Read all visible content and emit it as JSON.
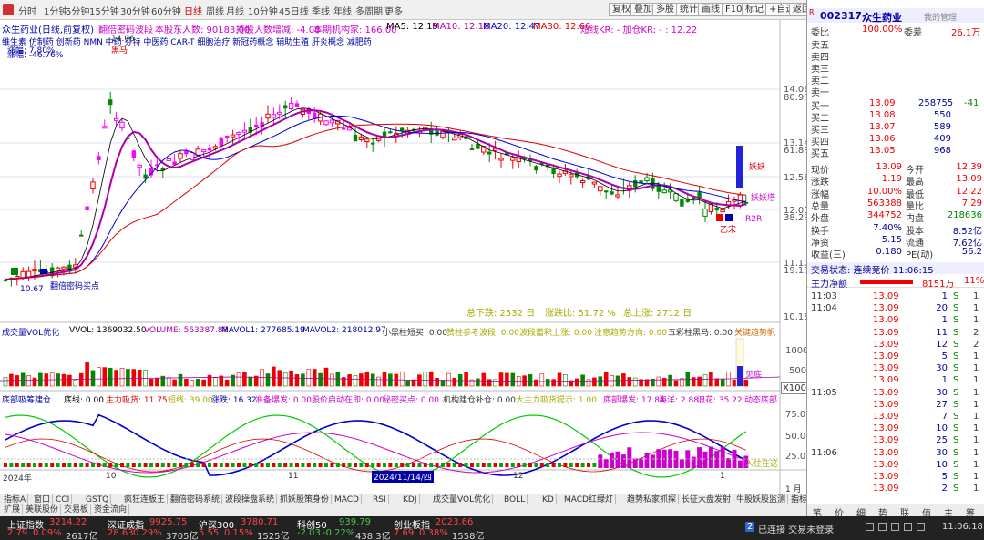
{
  "toolbar": {
    "periods": [
      "分时",
      "1分钟",
      "5分钟",
      "15分钟",
      "30分钟",
      "60分钟",
      "日线",
      "周线",
      "月线",
      "10分钟",
      "45日线",
      "季线",
      "年线",
      "多周期",
      "更多"
    ],
    "active_period": "日线",
    "buttons": [
      "复权",
      "叠加",
      "多股",
      "统计",
      "画线",
      "F10",
      "标记",
      "+自选",
      "返回"
    ]
  },
  "info": {
    "stock_line": "众生药业(日线,前复权)",
    "indicator": "翻倍密码波段",
    "holders": "本股东人数: 90183.00",
    "holders_change": "持股人数增减: -4.08",
    "inst_count": "本期机构家: 166.00",
    "ma5": "MA5: 12.19",
    "ma10": "MA10: 12.18",
    "ma20": "MA20: 12.47",
    "ma30": "MA30: 12.66",
    "macro": "短线KR: - 加仓KR: - : 12.22",
    "concepts": "维生素 仿制药 创新药 NMN 中药 芬特 中医药 CAR-T 细胞治疗 新冠药概念 辅助生殖 肝炎概念 减肥药",
    "float1": "涨幅: 7.80%",
    "float2": "涨幅: -46.76%",
    "hl_high": "14.06",
    "hl_low": "10.67",
    "label_tag": "翻倍密码买点",
    "label_black": "黑马",
    "label_yao": "妖妖",
    "label_yaota": "妖妖塔",
    "label_nie": "乙宋",
    "label_rzr": "R2R",
    "label_z": "乙",
    "stats_down": "总下跌: 2532 日",
    "stats_rate": "涨跌比: 51.72 %",
    "stats_up": "总上涨: 2712 日"
  },
  "yaxis_price": [
    {
      "v": "14.06",
      "c": "dark"
    },
    {
      "v": "80.9%",
      "c": "dark"
    },
    {
      "v": "13.14",
      "c": "dark"
    },
    {
      "v": "61.8%",
      "c": "dark"
    },
    {
      "v": "12.58",
      "c": "dark"
    },
    {
      "v": "12.01",
      "c": "dark"
    },
    {
      "v": "38.2%",
      "c": "dark"
    },
    {
      "v": "11.10",
      "c": "dark"
    },
    {
      "v": "19.1%",
      "c": "dark"
    },
    {
      "v": "10.18",
      "c": "dark"
    }
  ],
  "vol_panel": {
    "title": "成交量VOL优化",
    "vvol": "VVOL: 1369032.50",
    "volume": "VOLUME: 563387.88",
    "mavol1": "MAVOL1: 277685.19",
    "mavol2": "MAVOL2: 218012.97",
    "xiao": "小黑柱短买: 0.00",
    "hong": "赞柱参考波段: 0.00",
    "bo": "波段蓄积上涨: 0.00",
    "zhu": "注意趋势方向: 0.00",
    "wu": "五彩柱黑马: 0.00",
    "key": "关键趋势帆",
    "yticks": [
      "10000",
      "5000"
    ],
    "label": "见底"
  },
  "osc_panel": {
    "title": "底部吸筹建仓",
    "d1": "底线: 0.00",
    "d2": "主力吸货: 11.75",
    "d3": "短线: 39.00",
    "d4": "涨跌: 16.32",
    "d5": "准备爆发: 0.00",
    "d6": "股价启动在即: 0.00",
    "d7": "秘密买点: 0.00",
    "d8": "机构建仓补仓: 0.00",
    "d9": "大主力吸货提示: 1.00",
    "d10": "底部爆发: 17.84",
    "d11": "海洋: 2.88",
    "d12": "浪花: 35.22",
    "d13": "动态底部",
    "yticks": [
      "75.00",
      "50.00",
      "25.00"
    ],
    "label": "入住在这",
    "x100": "X100"
  },
  "xaxis": [
    "2024年",
    "10",
    "11",
    "2024/11/14/四",
    "12",
    "1",
    "1 月"
  ],
  "bottom_tabs": [
    "指标A",
    "窗口",
    "CCI",
    "GSTQ",
    "疯狂连板王",
    "翻倍密码系统",
    "波段操盘系统",
    "抓妖股策身份",
    "MACD",
    "RSI",
    "KDJ",
    "成交量VOL优化",
    "BOLL",
    "KD",
    "MACD红绿灯",
    "趋势私家抓探",
    "长征大盘发射",
    "牛股妖股监测",
    "指标B",
    "模板"
  ],
  "bottom_tabs2": [
    "扩展",
    "美联股份",
    "交易板",
    "资金流向"
  ],
  "rpanel": {
    "code": "002317",
    "name": "众生药业",
    "sub": "我的管理",
    "weibi_label": "委比",
    "weibi": "100.00%",
    "weicha_label": "委差",
    "weicha": "26.1万",
    "sells": [
      {
        "l": "卖五",
        "p": "",
        "v": ""
      },
      {
        "l": "卖四",
        "p": "",
        "v": ""
      },
      {
        "l": "卖三",
        "p": "",
        "v": ""
      },
      {
        "l": "卖二",
        "p": "",
        "v": ""
      },
      {
        "l": "卖一",
        "p": "",
        "v": ""
      }
    ],
    "buys": [
      {
        "l": "买一",
        "p": "13.09",
        "v": "258755",
        "c": "-41"
      },
      {
        "l": "买二",
        "p": "13.08",
        "v": "550",
        "c": ""
      },
      {
        "l": "买三",
        "p": "13.07",
        "v": "589",
        "c": ""
      },
      {
        "l": "买四",
        "p": "13.06",
        "v": "409",
        "c": ""
      },
      {
        "l": "买五",
        "p": "13.05",
        "v": "968",
        "c": ""
      }
    ],
    "quote": [
      {
        "a": "现价",
        "b": "13.09",
        "c": "今开",
        "d": "12.39"
      },
      {
        "a": "涨跌",
        "b": "1.19",
        "c": "最高",
        "d": "13.09"
      },
      {
        "a": "涨幅",
        "b": "10.00%",
        "c": "最低",
        "d": "12.22"
      },
      {
        "a": "总量",
        "b": "563388",
        "c": "量比",
        "d": "7.29"
      },
      {
        "a": "外盘",
        "b": "344752",
        "c": "内盘",
        "d": "218636"
      },
      {
        "a": "换手",
        "b": "7.40%",
        "c": "股本",
        "d": "8.52亿"
      },
      {
        "a": "净资",
        "b": "5.15",
        "c": "流通",
        "d": "7.62亿"
      },
      {
        "a": "收益(三)",
        "b": "0.180",
        "c": "PE(动)",
        "d": "56.2"
      }
    ],
    "state": "交易状态: 连续竞价 11:06:15",
    "netflow_label": "主力净额",
    "netflow": "8151万",
    "netflow_pct": "11%",
    "ticks": [
      {
        "t": "11:03",
        "p": "13.09",
        "v": "1",
        "d": "S",
        "n": "1"
      },
      {
        "t": "11:04",
        "p": "13.09",
        "v": "20",
        "d": "S",
        "n": "1"
      },
      {
        "t": "",
        "p": "13.09",
        "v": "1",
        "d": "S",
        "n": "1"
      },
      {
        "t": "",
        "p": "13.09",
        "v": "11",
        "d": "S",
        "n": "2"
      },
      {
        "t": "",
        "p": "13.09",
        "v": "12",
        "d": "S",
        "n": "2"
      },
      {
        "t": "",
        "p": "13.09",
        "v": "5",
        "d": "S",
        "n": "1"
      },
      {
        "t": "",
        "p": "13.09",
        "v": "30",
        "d": "S",
        "n": "1"
      },
      {
        "t": "",
        "p": "13.09",
        "v": "1",
        "d": "S",
        "n": "1"
      },
      {
        "t": "11:05",
        "p": "13.09",
        "v": "30",
        "d": "S",
        "n": "1"
      },
      {
        "t": "",
        "p": "13.09",
        "v": "27",
        "d": "S",
        "n": "1"
      },
      {
        "t": "",
        "p": "13.09",
        "v": "7",
        "d": "S",
        "n": "1"
      },
      {
        "t": "",
        "p": "13.09",
        "v": "10",
        "d": "S",
        "n": "1"
      },
      {
        "t": "",
        "p": "13.09",
        "v": "25",
        "d": "S",
        "n": "1"
      },
      {
        "t": "11:06",
        "p": "13.09",
        "v": "30",
        "d": "S",
        "n": "1"
      },
      {
        "t": "",
        "p": "13.09",
        "v": "10",
        "d": "S",
        "n": "1"
      },
      {
        "t": "",
        "p": "13.09",
        "v": "5",
        "d": "S",
        "n": "1"
      },
      {
        "t": "",
        "p": "13.09",
        "v": "2",
        "d": "S",
        "n": "1"
      }
    ],
    "tabs": [
      "笔",
      "价",
      "细",
      "势",
      "联",
      "值",
      "主",
      "筹"
    ]
  },
  "status": [
    {
      "name": "上证指数",
      "val": "3214.22",
      "chg": "2.79",
      "pct": "0.09%",
      "amt": "2617亿"
    },
    {
      "name": "深证成指",
      "val": "9925.75",
      "chg": "28.63",
      "pct": "0.29%",
      "amt": "3705亿"
    },
    {
      "name": "沪深300",
      "val": "3780.71",
      "chg": "5.55",
      "pct": "0.15%",
      "amt": "1525亿"
    },
    {
      "name": "科创50",
      "val": "939.79",
      "chg": "-2.03",
      "pct": "-0.22%",
      "amt": "438.3亿"
    },
    {
      "name": "创业板指",
      "val": "2023.66",
      "chg": "7.69",
      "pct": "0.38%",
      "amt": "1558亿"
    }
  ],
  "status_conn": "已连接 交易未登录",
  "status_time": "11:06:18"
}
